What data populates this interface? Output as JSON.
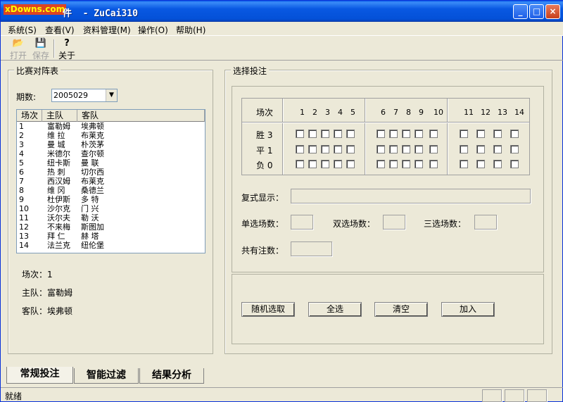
{
  "window": {
    "logo_text": "xDowns.com",
    "title": "件  - ZuCai310",
    "min_icon": "_",
    "max_icon": "□",
    "close_icon": "×"
  },
  "menu": [
    {
      "label": "系统(S)"
    },
    {
      "label": "查看(V)"
    },
    {
      "label": "资料管理(M)"
    },
    {
      "label": "操作(O)"
    },
    {
      "label": "帮助(H)"
    }
  ],
  "toolbar": {
    "open": {
      "label": "打开",
      "icon": "📂"
    },
    "save": {
      "label": "保存",
      "icon": "💾"
    },
    "about": {
      "label": "关于",
      "icon": "?"
    }
  },
  "left_panel": {
    "group_title": "比赛对阵表",
    "period_label": "期数:",
    "period_value": "2005029",
    "columns": [
      "场次",
      "主队",
      "客队"
    ],
    "rows": [
      [
        "1",
        "富勒姆",
        "埃弗顿"
      ],
      [
        "2",
        "维 拉",
        "布莱克"
      ],
      [
        "3",
        "曼 城",
        "朴茨茅"
      ],
      [
        "4",
        "米德尔",
        "查尔顿"
      ],
      [
        "5",
        "纽卡斯",
        "曼 联"
      ],
      [
        "6",
        "热 刺",
        "切尔西"
      ],
      [
        "7",
        "西汉姆",
        "布莱克"
      ],
      [
        "8",
        "维 冈",
        "桑德兰"
      ],
      [
        "9",
        "杜伊斯",
        "多 特"
      ],
      [
        "10",
        "沙尔克",
        "门 兴"
      ],
      [
        "11",
        "沃尔夫",
        "勒 沃"
      ],
      [
        "12",
        "不来梅",
        "斯图加"
      ],
      [
        "13",
        "拜 仁",
        "赫 塔"
      ],
      [
        "14",
        "法兰克",
        "纽伦堡"
      ]
    ],
    "detail_match": "场次：1",
    "detail_home": "主队：富勒姆",
    "detail_away": "客队：埃弗顿"
  },
  "right_panel": {
    "group_title": "选择投注",
    "header_label": "场次",
    "match_numbers": [
      "1",
      "2",
      "3",
      "4",
      "5",
      "6",
      "7",
      "8",
      "9",
      "10",
      "11",
      "12",
      "13",
      "14"
    ],
    "outcomes": [
      "胜 3",
      "平 1",
      "负 0"
    ],
    "compound_label": "复式显示：",
    "single_label": "单选场数：",
    "double_label": "双选场数：",
    "triple_label": "三选场数：",
    "total_label": "共有注数：",
    "buttons": {
      "random": "随机选取",
      "select_all": "全选",
      "clear": "清空",
      "add": "加入"
    }
  },
  "tabs": [
    "常规投注",
    "智能过滤",
    "结果分析"
  ],
  "status": {
    "text": "就绪"
  }
}
